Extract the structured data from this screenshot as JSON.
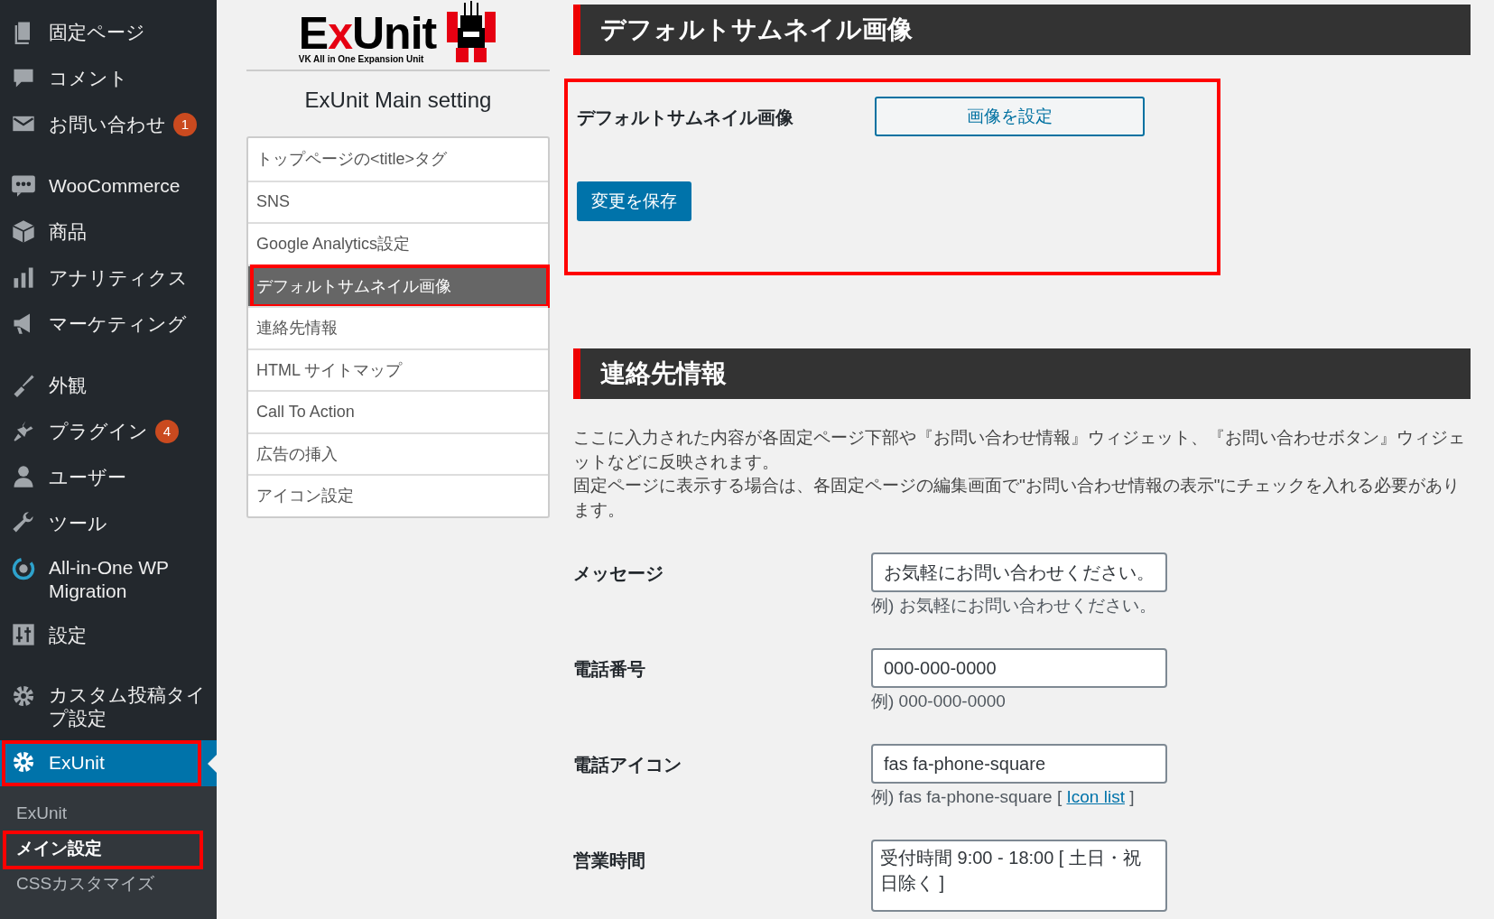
{
  "sidebar": {
    "groups": [
      {
        "items": [
          {
            "label": "固定ページ",
            "selected": false
          },
          {
            "label": "コメント",
            "selected": false
          },
          {
            "label": "お問い合わせ",
            "selected": false,
            "badge": "1"
          }
        ]
      },
      {
        "items": [
          {
            "label": "WooCommerce",
            "selected": false
          },
          {
            "label": "商品",
            "selected": false
          },
          {
            "label": "アナリティクス",
            "selected": false
          },
          {
            "label": "マーケティング",
            "selected": false
          }
        ]
      },
      {
        "items": [
          {
            "label": "外観",
            "selected": false
          },
          {
            "label": "プラグイン",
            "selected": false,
            "badge": "4"
          },
          {
            "label": "ユーザー",
            "selected": false
          },
          {
            "label": "ツール",
            "selected": false
          },
          {
            "label": "All-in-One WP Migration",
            "selected": false
          },
          {
            "label": "設定",
            "selected": false
          }
        ]
      },
      {
        "items": [
          {
            "label": "カスタム投稿タイプ設定",
            "selected": false,
            "highlighted": false
          },
          {
            "label": "ExUnit",
            "selected": true,
            "highlighted": true
          }
        ]
      }
    ],
    "submenu": [
      {
        "label": "ExUnit",
        "selected": false,
        "highlighted": false
      },
      {
        "label": "メイン設定",
        "selected": true,
        "highlighted": true
      },
      {
        "label": "CSSカスタマイズ",
        "selected": false,
        "highlighted": false
      }
    ]
  },
  "logo": {
    "title": "ExUnit",
    "subtitle": "VK All in One Expansion Unit"
  },
  "settings_title": "ExUnit Main setting",
  "nav": [
    {
      "label": "トップページの<title>タグ",
      "selected": false,
      "highlighted": false
    },
    {
      "label": "SNS",
      "selected": false,
      "highlighted": false
    },
    {
      "label": "Google Analytics設定",
      "selected": false,
      "highlighted": false
    },
    {
      "label": "デフォルトサムネイル画像",
      "selected": true,
      "highlighted": true
    },
    {
      "label": "連絡先情報",
      "selected": false,
      "highlighted": false
    },
    {
      "label": "HTML サイトマップ",
      "selected": false,
      "highlighted": false
    },
    {
      "label": "Call To Action",
      "selected": false,
      "highlighted": false
    },
    {
      "label": "広告の挿入",
      "selected": false,
      "highlighted": false
    },
    {
      "label": "アイコン設定",
      "selected": false,
      "highlighted": false
    }
  ],
  "thumbnail_section": {
    "title": "デフォルトサムネイル画像",
    "highlighted": true,
    "label": "デフォルトサムネイル画像",
    "set_button": "画像を設定",
    "save_button": "変更を保存"
  },
  "contact_section": {
    "title": "連絡先情報",
    "description": [
      "ここに入力された内容が各固定ページ下部や『お問い合わせ情報』ウィジェット、『お問い合わせボタン』ウィジェットなどに反映されます。",
      "固定ページに表示する場合は、各固定ページの編集画面で\"お問い合わせ情報の表示\"にチェックを入れる必要があります。"
    ],
    "fields": [
      {
        "kind": "input",
        "label": "メッセージ",
        "value": "お気軽にお問い合わせください。",
        "hint": "例) お気軽にお問い合わせください。"
      },
      {
        "kind": "input",
        "label": "電話番号",
        "value": "000-000-0000",
        "hint": "例) 000-000-0000"
      },
      {
        "kind": "input",
        "label": "電話アイコン",
        "value": "fas fa-phone-square",
        "hint": "例) fas fa-phone-square [ ",
        "link": "Icon list",
        "hint_end": " ]"
      },
      {
        "kind": "textarea",
        "label": "営業時間",
        "value": "受付時間 9:00 - 18:00 [ 土日・祝日除く ]"
      }
    ]
  }
}
